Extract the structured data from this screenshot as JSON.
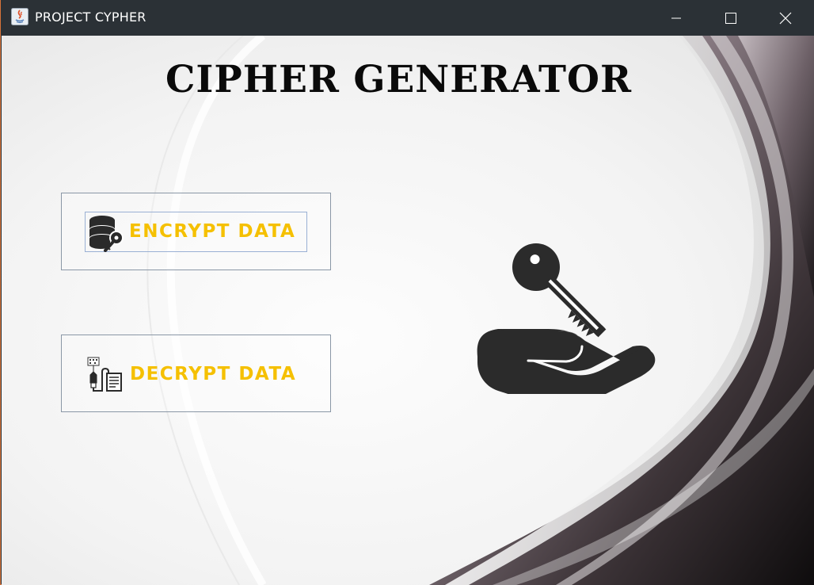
{
  "window": {
    "title": "PROJECT CYPHER",
    "controls": [
      "minimize",
      "maximize",
      "close"
    ]
  },
  "header": {
    "title": "CIPHER GENERATOR"
  },
  "buttons": {
    "encrypt": {
      "label": "ENCRYPT DATA",
      "icon": "database-key-icon"
    },
    "decrypt": {
      "label": "DECRYPT DATA",
      "icon": "decrypt-usb-document-icon"
    }
  },
  "illustration": {
    "icon": "key-in-hand-icon"
  },
  "colors": {
    "titlebar": "#2b3136",
    "button_text": "#f5c000",
    "heading": "#0a0a0a",
    "button_border": "#8a97a6"
  }
}
